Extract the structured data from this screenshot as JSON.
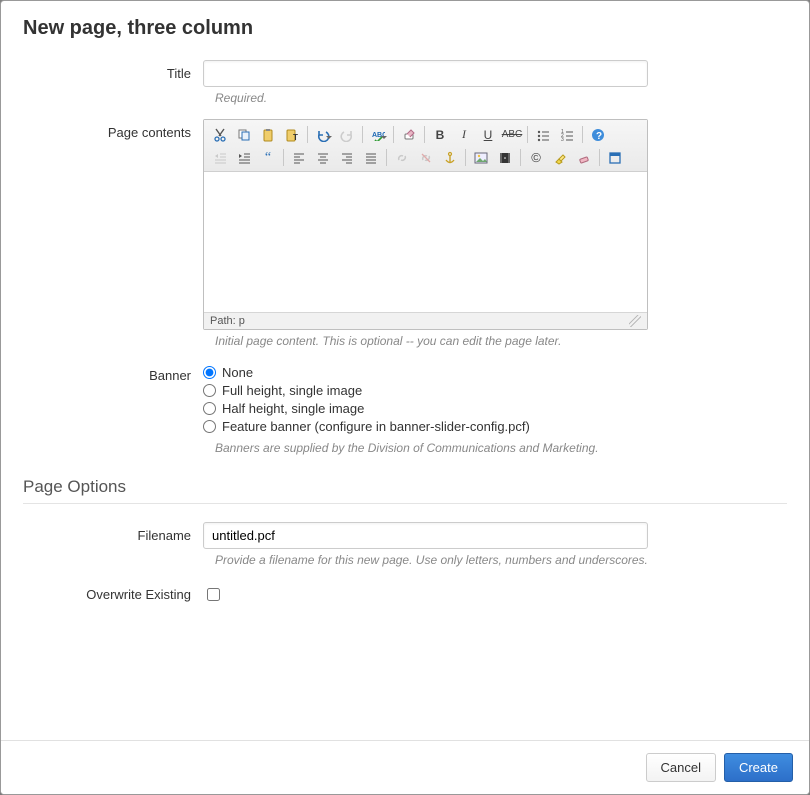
{
  "modal": {
    "title": "New page, three column"
  },
  "fields": {
    "title": {
      "label": "Title",
      "value": "",
      "help": "Required."
    },
    "page_contents": {
      "label": "Page contents",
      "path_text": "Path: p",
      "help": "Initial page content. This is optional -- you can edit the page later."
    },
    "banner": {
      "label": "Banner",
      "options": [
        "None",
        "Full height, single image",
        "Half height, single image",
        "Feature banner (configure in banner-slider-config.pcf)"
      ],
      "selected_index": 0,
      "help": "Banners are supplied by the Division of Communications and Marketing."
    }
  },
  "page_options": {
    "heading": "Page Options",
    "filename": {
      "label": "Filename",
      "value": "untitled.pcf",
      "help": "Provide a filename for this new page. Use only letters, numbers and underscores."
    },
    "overwrite": {
      "label": "Overwrite Existing",
      "checked": false
    }
  },
  "footer": {
    "cancel": "Cancel",
    "create": "Create"
  },
  "toolbar": {
    "row1": [
      "cut",
      "copy",
      "paste",
      "paste-text",
      "sep",
      "undo",
      "redo",
      "sep",
      "spellcheck",
      "sep",
      "clear-format",
      "sep",
      "bold",
      "italic",
      "underline",
      "strike",
      "sep",
      "bullet-list",
      "number-list",
      "sep",
      "help"
    ],
    "row2": [
      "outdent",
      "indent",
      "blockquote",
      "sep",
      "align-left",
      "align-center",
      "align-right",
      "align-justify",
      "sep",
      "link",
      "unlink",
      "anchor",
      "sep",
      "image",
      "media",
      "sep",
      "copyright",
      "highlight",
      "eraser",
      "sep",
      "fullscreen"
    ]
  }
}
